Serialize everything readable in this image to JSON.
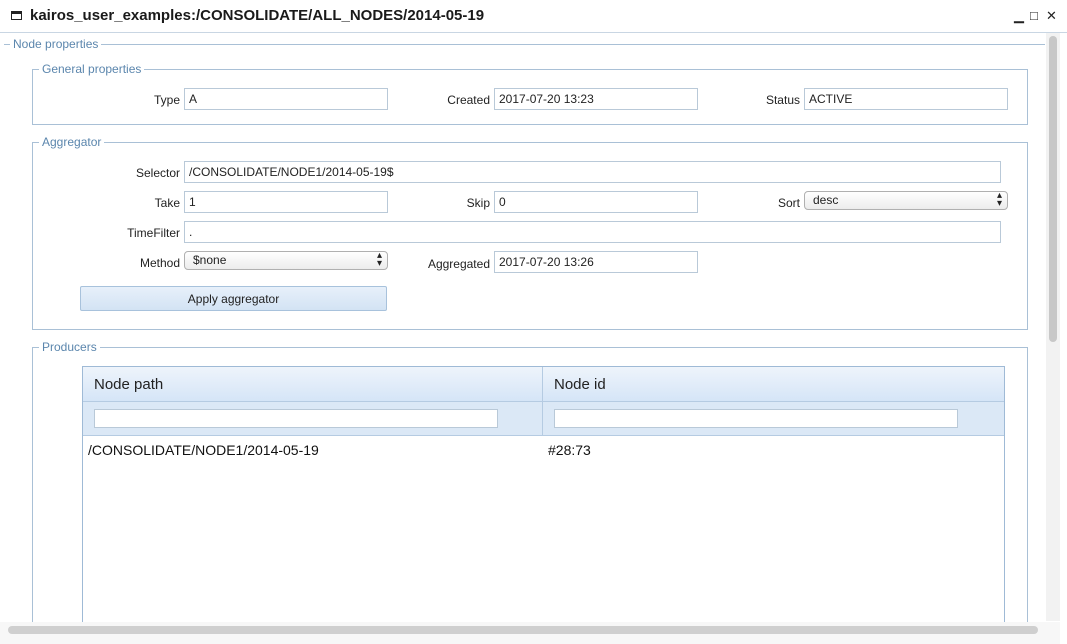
{
  "window": {
    "title": "kairos_user_examples:/CONSOLIDATE/ALL_NODES/2014-05-19",
    "controls": {
      "minimize": "▁",
      "maximize": "□",
      "close": "✕"
    }
  },
  "node_properties": {
    "legend": "Node properties",
    "general": {
      "legend": "General properties",
      "type_label": "Type",
      "type_value": "A",
      "created_label": "Created",
      "created_value": "2017-07-20 13:23",
      "status_label": "Status",
      "status_value": "ACTIVE"
    },
    "aggregator": {
      "legend": "Aggregator",
      "selector_label": "Selector",
      "selector_value": "/CONSOLIDATE/NODE1/2014-05-19$",
      "take_label": "Take",
      "take_value": "1",
      "skip_label": "Skip",
      "skip_value": "0",
      "sort_label": "Sort",
      "sort_value": "desc",
      "timefilter_label": "TimeFilter",
      "timefilter_value": ".",
      "method_label": "Method",
      "method_value": "$none",
      "aggregated_label": "Aggregated",
      "aggregated_value": "2017-07-20 13:26",
      "apply_button": "Apply aggregator"
    },
    "producers": {
      "legend": "Producers",
      "columns": [
        "Node path",
        "Node id"
      ],
      "rows": [
        {
          "path": "/CONSOLIDATE/NODE1/2014-05-19",
          "id": "#28:73"
        }
      ]
    }
  }
}
